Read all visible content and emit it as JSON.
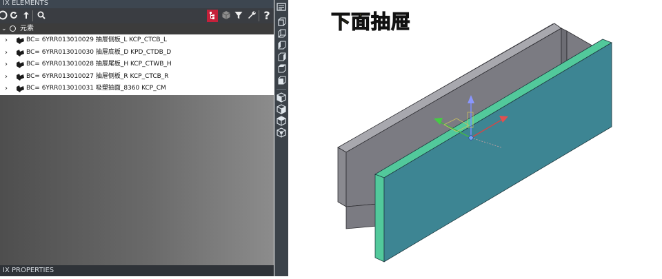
{
  "panel": {
    "title": "IX ELEMENTS",
    "root_label": "元素",
    "items": [
      {
        "label": "BC= 6YRR013010029 抽屉侧板_L KCP_CTCB_L"
      },
      {
        "label": "BC= 6YRR013010030 抽屉底板_D KPD_CTDB_D"
      },
      {
        "label": "BC= 6YRR013010028 抽屉尾板_H KCP_CTWB_H"
      },
      {
        "label": "BC= 6YRR013010027 抽屉侧板_R KCP_CTCB_R"
      },
      {
        "label": "BC= 6YRR013010031 吸塑抽面_8360 KCP_CM"
      }
    ],
    "help_label": "?"
  },
  "properties": {
    "title": "IX PROPERTIES"
  },
  "viewport": {
    "caption": "下面抽屉"
  },
  "colors": {
    "panel_bg": "#5f5f5f",
    "title_bg": "#3d4650",
    "toolbar_bg": "#3a3d42",
    "highlight_red": "#c4213a",
    "front_panel": "#3d8593",
    "front_panel_edge": "#52c99b",
    "box_side": "#7b7b82",
    "box_inner": "#616168",
    "box_top": "#a0a0a6",
    "caption": "#f7ee3c"
  },
  "icons": {
    "toolbar": [
      "back-icon",
      "refresh-icon",
      "up-arrow-icon",
      "search-icon",
      "tree-view-icon",
      "cube-icon",
      "filter-icon",
      "wrench-icon",
      "help-icon"
    ],
    "row": "component-icon",
    "vertical_toolbar": [
      "view-settings-icon",
      "front-view-icon",
      "back-view-icon",
      "left-view-icon",
      "right-view-icon",
      "top-view-icon",
      "bottom-view-icon",
      "iso-sw-icon",
      "iso-se-icon",
      "iso-ne-icon",
      "iso-nw-icon"
    ]
  }
}
